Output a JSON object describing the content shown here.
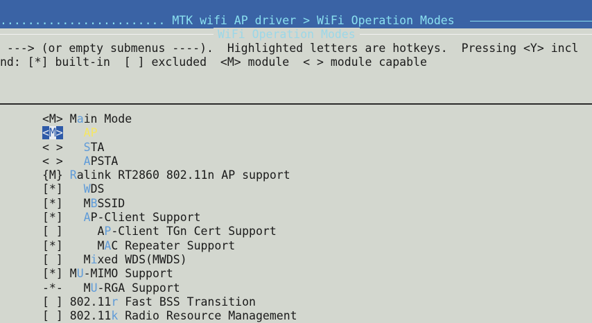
{
  "header": {
    "dots": "........................",
    "breadcrumb": "MTK wifi AP driver > WiFi Operation Modes"
  },
  "frame": {
    "title": "WiFi Operation Modes"
  },
  "help": {
    "line1": " ---> (or empty submenus ----).  Highlighted letters are hotkeys.  Pressing <Y> incl",
    "line2": "nd: [*] built-in  [ ] excluded  <M> module  < > module capable"
  },
  "menu": {
    "items": [
      {
        "mark": "<M>",
        "indent": " ",
        "pre": "M",
        "hot": "a",
        "post": "in Mode",
        "selected": false
      },
      {
        "mark": "<M>",
        "indent": "   ",
        "pre": "",
        "hot": "A",
        "post": "P",
        "selected": true
      },
      {
        "mark": "< >",
        "indent": "   ",
        "pre": "",
        "hot": "S",
        "post": "TA",
        "selected": false
      },
      {
        "mark": "< >",
        "indent": "   ",
        "pre": "",
        "hot": "A",
        "post": "PSTA",
        "selected": false
      },
      {
        "mark": "{M}",
        "indent": " ",
        "pre": "",
        "hot": "R",
        "post": "alink RT2860 802.11n AP support",
        "selected": false
      },
      {
        "mark": "[*]",
        "indent": "   ",
        "pre": "",
        "hot": "W",
        "post": "DS",
        "selected": false
      },
      {
        "mark": "[*]",
        "indent": "   ",
        "pre": "M",
        "hot": "B",
        "post": "SSID",
        "selected": false
      },
      {
        "mark": "[*]",
        "indent": "   ",
        "pre": "",
        "hot": "A",
        "post": "P-Client Support",
        "selected": false
      },
      {
        "mark": "[ ]",
        "indent": "     ",
        "pre": "A",
        "hot": "P",
        "post": "-Client TGn Cert Support",
        "selected": false
      },
      {
        "mark": "[*]",
        "indent": "     ",
        "pre": "M",
        "hot": "A",
        "post": "C Repeater Support",
        "selected": false
      },
      {
        "mark": "[ ]",
        "indent": "   ",
        "pre": "M",
        "hot": "i",
        "post": "xed WDS(MWDS)",
        "selected": false
      },
      {
        "mark": "[*]",
        "indent": " ",
        "pre": "M",
        "hot": "U",
        "post": "-MIMO Support",
        "selected": false
      },
      {
        "mark": "-*-",
        "indent": "   ",
        "pre": "M",
        "hot": "U",
        "post": "-RGA Support",
        "selected": false
      },
      {
        "mark": "[ ]",
        "indent": " ",
        "pre": "802.11",
        "hot": "r",
        "post": " Fast BSS Transition",
        "selected": false
      },
      {
        "mark": "[ ]",
        "indent": " ",
        "pre": "802.11",
        "hot": "k",
        "post": " Radio Resource Management",
        "selected": false
      }
    ]
  }
}
